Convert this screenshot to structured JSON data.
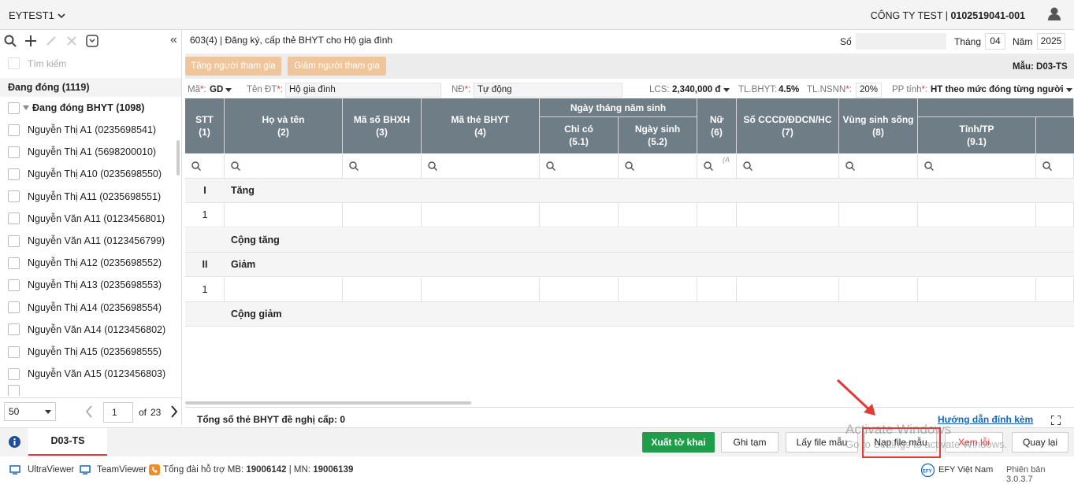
{
  "topbar": {
    "workspace": "EYTEST1",
    "company": "CÔNG TY TEST",
    "tax_code": "0102519041-001"
  },
  "sidebar": {
    "search_placeholder": "Tìm kiếm",
    "group_title": "Đang đóng (1119)",
    "subgroup": "Đang đóng BHYT (1098)",
    "items": [
      "Nguyễn Thị A1 (0235698541)",
      "Nguyễn Thị A1 (5698200010)",
      "Nguyễn Thị A10 (0235698550)",
      "Nguyễn Thị A11 (0235698551)",
      "Nguyễn Văn A11 (0123456801)",
      "Nguyễn Văn A11 (0123456799)",
      "Nguyễn Thị A12 (0235698552)",
      "Nguyễn Thị A13 (0235698553)",
      "Nguyễn Thị A14 (0235698554)",
      "Nguyễn Văn A14 (0123456802)",
      "Nguyễn Thị A15 (0235698555)",
      "Nguyễn Văn A15 (0123456803)"
    ],
    "page_size": "50",
    "page": "1",
    "of_label": "of",
    "total_pages": "23"
  },
  "form": {
    "code": "603(4)",
    "title": "| Đăng ký, cấp thẻ BHYT cho Hộ gia đình",
    "so_label": "Số",
    "so_value": "",
    "month_label": "Tháng",
    "month": "04",
    "year_label": "Năm",
    "year": "2025",
    "btn_add": "Tăng người tham gia",
    "btn_reduce": "Giảm người tham gia",
    "template_label": "Mẫu: D03-TS",
    "ma_label": "Mã",
    "ma_value": "GD",
    "tendt_label": "Tên ĐT",
    "tendt_value": "Hộ gia đình",
    "nd_label": "NĐ",
    "nd_value": "Tự động",
    "lcs_label": "LCS:",
    "lcs_value": "2,340,000 đ",
    "tlbhyt_label": "TL.BHYT:",
    "tlbhyt_value": "4.5%",
    "tlnsnn_label": "TL.NSNN",
    "tlnsnn_value": "20%",
    "pptinh_label": "PP tính",
    "pptinh_value": "HT theo mức đóng từng người"
  },
  "table": {
    "group_header": "Ngày tháng năm sinh",
    "headers": [
      {
        "t": "STT",
        "n": "(1)"
      },
      {
        "t": "Họ và tên",
        "n": "(2)"
      },
      {
        "t": "Mã số BHXH",
        "n": "(3)"
      },
      {
        "t": "Mã thẻ BHYT",
        "n": "(4)"
      },
      {
        "t": "Chỉ có",
        "n": "(5.1)"
      },
      {
        "t": "Ngày sinh",
        "n": "(5.2)"
      },
      {
        "t": "Nữ",
        "n": "(6)"
      },
      {
        "t": "Số CCCD/ĐDCN/HC",
        "n": "(7)"
      },
      {
        "t": "Vùng sinh sống",
        "n": "(8)"
      },
      {
        "t": "Tỉnh/TP",
        "n": "(9.1)"
      }
    ],
    "filter_hint": "(A",
    "rows": [
      {
        "stt": "I",
        "label": "Tăng"
      },
      {
        "stt": "1",
        "label": ""
      },
      {
        "stt": "",
        "label": "Cộng tăng"
      },
      {
        "stt": "II",
        "label": "Giảm"
      },
      {
        "stt": "1",
        "label": ""
      },
      {
        "stt": "",
        "label": "Cộng giảm"
      }
    ],
    "total_label": "Tổng số thẻ BHYT đề nghị cấp: 0",
    "guide_link": "Hướng dẫn đính kèm"
  },
  "footer": {
    "tab": "D03-TS",
    "buttons": {
      "submit": "Xuất tờ khai",
      "draft": "Ghi tạm",
      "get_template": "Lấy file mẫu",
      "load_template": "Nạp file mẫu",
      "errors": "Xem lỗi",
      "back": "Quay lại"
    },
    "watermark_line1": "Activate Windows",
    "watermark_line2": "Go to Settings to activate Windows."
  },
  "statusbar": {
    "ultraviewer": "UltraViewer",
    "teamviewer": "TeamViewer",
    "hotline": "Tổng đài hỗ trợ MB:",
    "mb": "19006142",
    "sep": "| MN:",
    "mn": "19006139",
    "brand": "EFY Việt Nam",
    "version": "Phiên bản 3.0.3.7"
  },
  "colors": {
    "header_bg": "#6f7d87",
    "accent_green": "#1e9e4a",
    "orange_btn": "#f0c59a",
    "link": "#1565c0",
    "highlight": "#e53935"
  }
}
